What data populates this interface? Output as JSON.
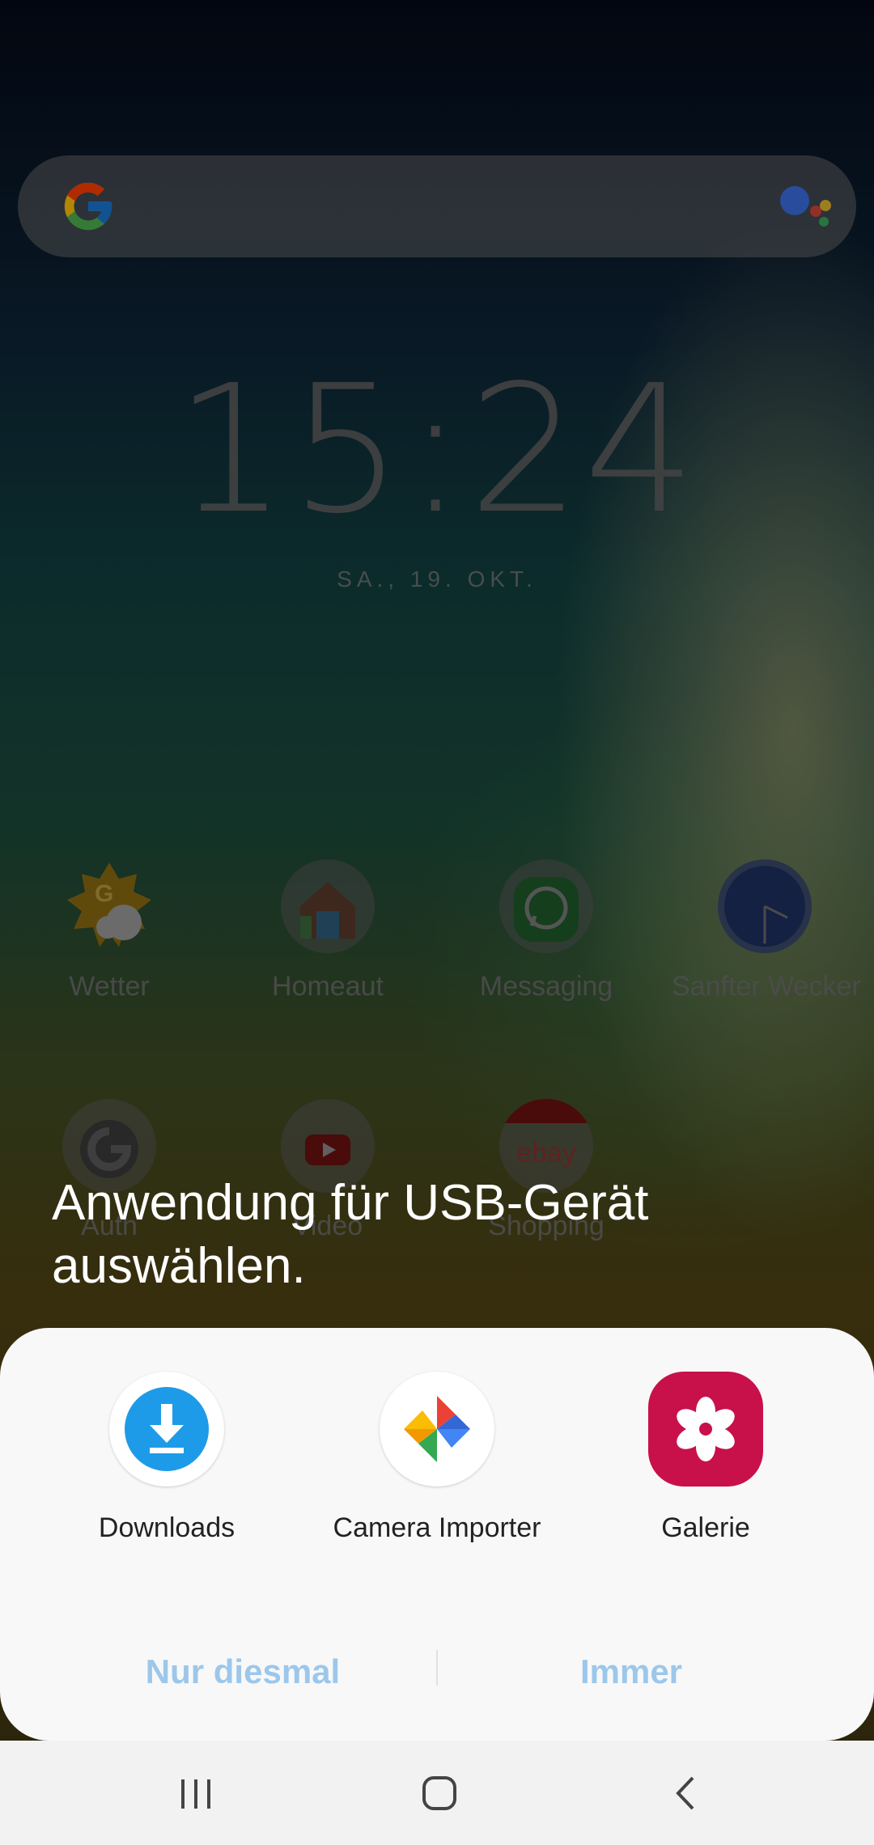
{
  "home": {
    "clock": "15:24",
    "date": "SA., 19. OKT.",
    "apps_row1": [
      {
        "label": "Wetter",
        "icon": "weather-icon"
      },
      {
        "label": "Homeaut",
        "icon": "home-icon"
      },
      {
        "label": "Messaging",
        "icon": "whatsapp-icon"
      },
      {
        "label": "Sanfter Wecker",
        "icon": "clock-icon"
      }
    ],
    "apps_row2": [
      {
        "label": "Auth",
        "icon": "auth-icon"
      },
      {
        "label": "Video",
        "icon": "youtube-icon"
      },
      {
        "label": "Shopping",
        "icon": "ebay-icon"
      }
    ],
    "ebay_text": "ebay"
  },
  "dialog": {
    "title": "Anwendung für USB-Gerät auswählen.",
    "options": [
      {
        "label": "Downloads",
        "icon": "download-icon"
      },
      {
        "label": "Camera Importer",
        "icon": "pinwheel-icon"
      },
      {
        "label": "Galerie",
        "icon": "flower-icon"
      }
    ],
    "just_once": "Nur diesmal",
    "always": "Immer"
  },
  "colors": {
    "accent_button": "#9cc7eb",
    "gallery": "#c8104a",
    "downloads": "#1e9be8"
  }
}
